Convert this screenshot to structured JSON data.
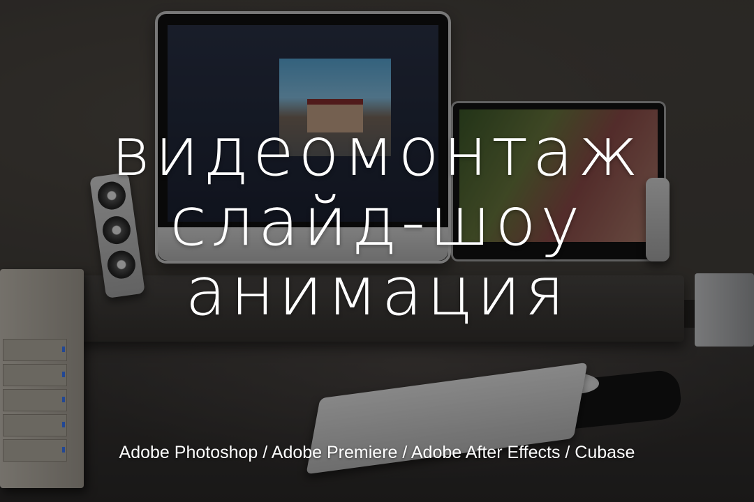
{
  "headline": {
    "line1": "видеомонтаж",
    "line2": "слайд-шоу",
    "line3": "анимация"
  },
  "caption": "Adobe Photoshop / Adobe Premiere / Adobe After Effects / Cubase",
  "colors": {
    "text": "#ffffff",
    "overlay": "rgba(0,0,0,0.42)"
  }
}
